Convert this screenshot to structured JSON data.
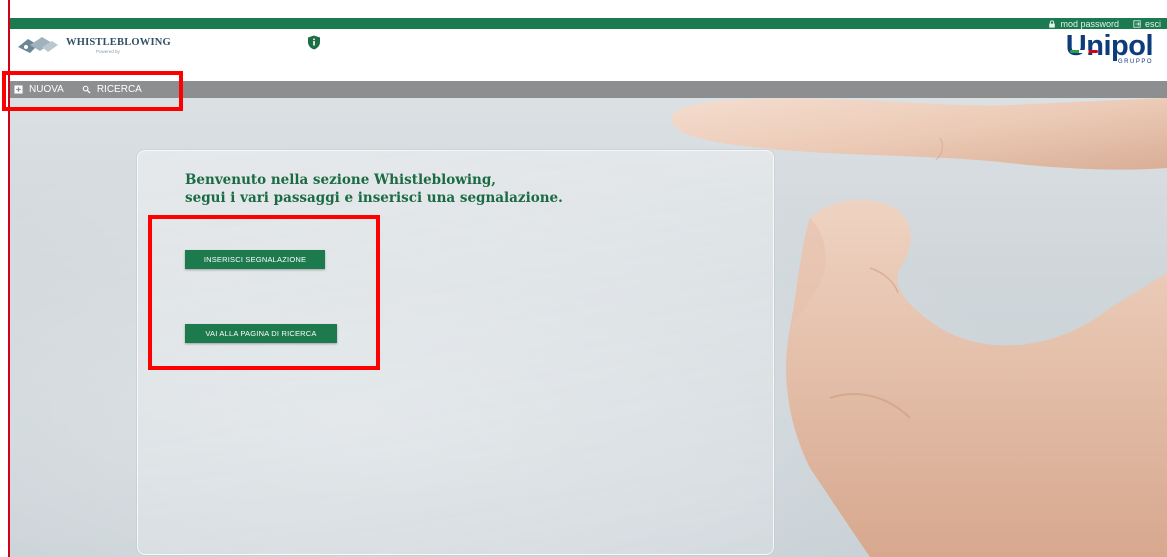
{
  "topbar": {
    "mod_password": "mod password",
    "esci": "esci",
    "lock_icon": "lock-icon",
    "exit_icon": "exit-icon",
    "accent": "#1b7a4f"
  },
  "header": {
    "app_name": "WHISTLEBLOWING",
    "app_sub": "Powered by",
    "brand": "Unipol",
    "brand_sub": "GRUPPO",
    "brand_color": "#0d3c7a"
  },
  "navbar": {
    "items": [
      {
        "label": "NUOVA",
        "icon": "plus-square-icon"
      },
      {
        "label": "RICERCA",
        "icon": "search-icon"
      }
    ]
  },
  "main": {
    "welcome_line1": "Benvenuto nella sezione Whistleblowing,",
    "welcome_line2": "segui i vari passaggi e inserisci una segnalazione.",
    "insert_button": "INSERISCI SEGNALAZIONE",
    "search_button": "VAI ALLA PAGINA DI RICERCA",
    "button_color": "#1d7a4c"
  }
}
